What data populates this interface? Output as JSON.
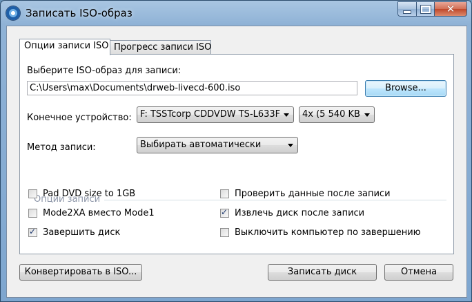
{
  "window": {
    "title": "Записать ISO-образ"
  },
  "tabs": [
    {
      "label": "Опции записи ISO",
      "active": true
    },
    {
      "label": "Прогресс записи ISO",
      "active": false
    }
  ],
  "image": {
    "label": "Выберите ISO-образ для записи:",
    "path": "C:\\Users\\max\\Documents\\drweb-livecd-600.iso",
    "browse": "Browse..."
  },
  "device": {
    "label": "Конечное устройство:",
    "selected": "F: TSSTcorp CDDVDW TS-L633F",
    "speed": "4x (5 540 KB"
  },
  "method": {
    "label": "Метод записи:",
    "selected": "Выбирать автоматически"
  },
  "options": {
    "title": "Опции записи",
    "items": [
      {
        "label": "Pad DVD size to 1GB",
        "checked": false
      },
      {
        "label": "Mode2XA вместо Mode1",
        "checked": false
      },
      {
        "label": "Завершить диск",
        "checked": true
      },
      {
        "label": "Проверить данные после записи",
        "checked": false
      },
      {
        "label": "Извлечь диск после записи",
        "checked": true
      },
      {
        "label": "Выключить компьютер по завершению",
        "checked": false
      }
    ]
  },
  "footer": {
    "convert": "Конвертировать в ISO...",
    "burn": "Записать диск",
    "cancel": "Отмена"
  }
}
